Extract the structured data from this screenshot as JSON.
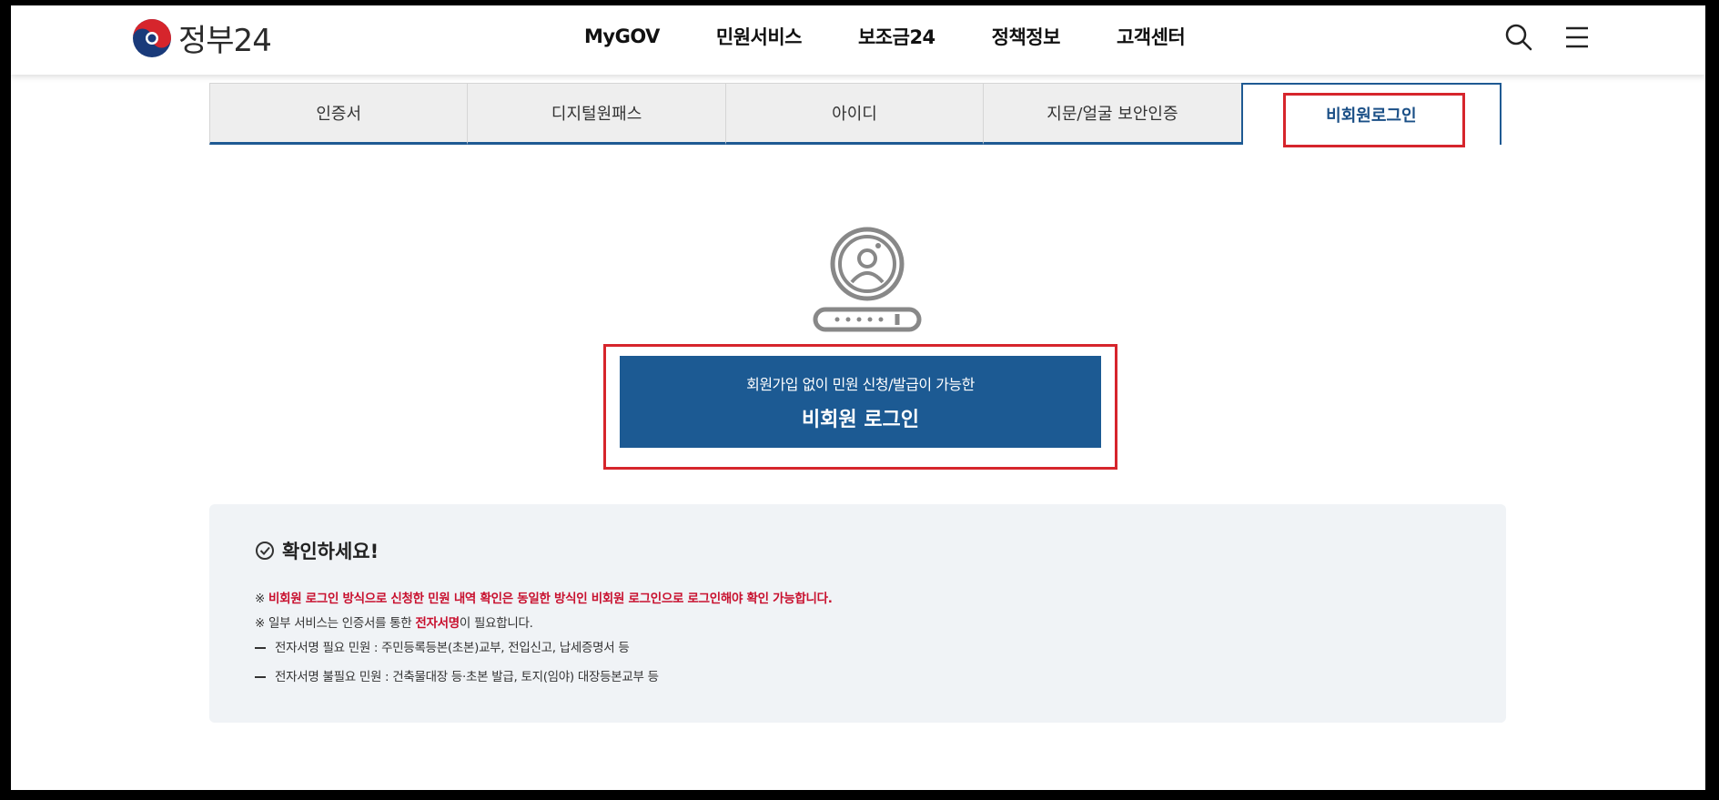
{
  "header": {
    "logo_text": "정부24",
    "nav": [
      "MyGOV",
      "민원서비스",
      "보조금24",
      "정책정보",
      "고객센터"
    ]
  },
  "tabs": [
    "인증서",
    "디지털원패스",
    "아이디",
    "지문/얼굴 보안인증",
    "비회원로그인"
  ],
  "active_tab_index": 4,
  "guest_button": {
    "subtitle": "회원가입 없이 민원 신청/발급이 가능한",
    "title": "비회원 로그인"
  },
  "notice": {
    "title": "확인하세요!",
    "line1_mark": "※ ",
    "line1_red": "비회원 로그인 방식으로 신청한 민원 내역 확인은 동일한 방식인 비회원 로그인으로 로그인해야 확인 가능합니다.",
    "line2_prefix": "※ 일부 서비스는 인증서를 통한 ",
    "line2_red": "전자서명",
    "line2_suffix": "이 필요합니다.",
    "line3": "전자서명 필요 민원 : 주민등록등본(초본)교부, 전입신고, 납세증명서 등",
    "line4": "전자서명 불필요 민원 : 건축물대장 등·초본 발급, 토지(임야) 대장등본교부 등"
  },
  "colors": {
    "primary": "#1c5a93",
    "highlight": "#d6252c",
    "notice_bg": "#f0f3f6",
    "red_text": "#c8102e"
  }
}
